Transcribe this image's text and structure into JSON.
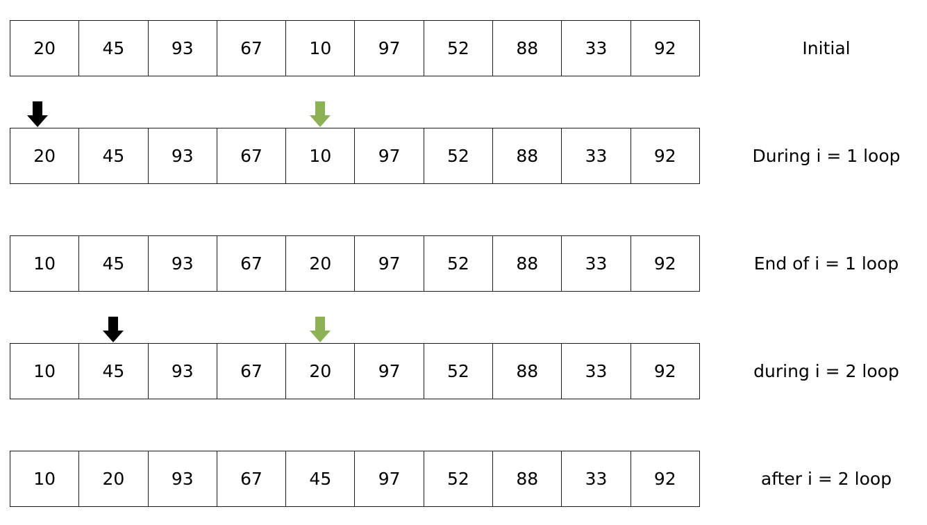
{
  "colors": {
    "outer_pointer": "#000000",
    "inner_pointer": "#8db255",
    "cell_border": "#1a1a1a"
  },
  "rows": [
    {
      "label": "Initial",
      "values": [
        "20",
        "45",
        "93",
        "67",
        "10",
        "97",
        "52",
        "88",
        "33",
        "92"
      ]
    },
    {
      "label": "During i = 1 loop",
      "values": [
        "20",
        "45",
        "93",
        "67",
        "10",
        "97",
        "52",
        "88",
        "33",
        "92"
      ]
    },
    {
      "label": "End of i = 1 loop",
      "values": [
        "10",
        "45",
        "93",
        "67",
        "20",
        "97",
        "52",
        "88",
        "33",
        "92"
      ]
    },
    {
      "label": "during i = 2 loop",
      "values": [
        "10",
        "45",
        "93",
        "67",
        "20",
        "97",
        "52",
        "88",
        "33",
        "92"
      ]
    },
    {
      "label": "after i = 2 loop",
      "values": [
        "10",
        "20",
        "93",
        "67",
        "45",
        "97",
        "52",
        "88",
        "33",
        "92"
      ]
    }
  ],
  "pointers": [
    {
      "row": 1,
      "index": 0,
      "kind": "outer",
      "icon": "black-down-arrow-icon"
    },
    {
      "row": 1,
      "index": 4,
      "kind": "inner",
      "icon": "green-down-arrow-icon"
    },
    {
      "row": 3,
      "index": 1,
      "kind": "outer",
      "icon": "black-down-arrow-icon"
    },
    {
      "row": 3,
      "index": 4,
      "kind": "inner",
      "icon": "green-down-arrow-icon"
    }
  ]
}
